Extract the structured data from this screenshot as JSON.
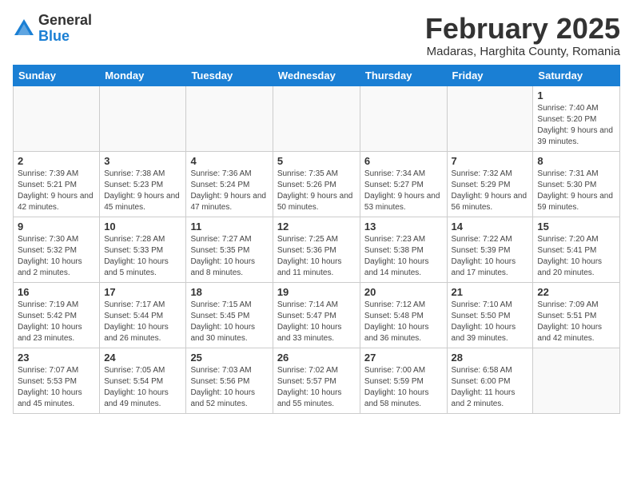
{
  "header": {
    "logo_general": "General",
    "logo_blue": "Blue",
    "title": "February 2025",
    "subtitle": "Madaras, Harghita County, Romania"
  },
  "days_of_week": [
    "Sunday",
    "Monday",
    "Tuesday",
    "Wednesday",
    "Thursday",
    "Friday",
    "Saturday"
  ],
  "weeks": [
    [
      {
        "day": "",
        "info": ""
      },
      {
        "day": "",
        "info": ""
      },
      {
        "day": "",
        "info": ""
      },
      {
        "day": "",
        "info": ""
      },
      {
        "day": "",
        "info": ""
      },
      {
        "day": "",
        "info": ""
      },
      {
        "day": "1",
        "info": "Sunrise: 7:40 AM\nSunset: 5:20 PM\nDaylight: 9 hours and 39 minutes."
      }
    ],
    [
      {
        "day": "2",
        "info": "Sunrise: 7:39 AM\nSunset: 5:21 PM\nDaylight: 9 hours and 42 minutes."
      },
      {
        "day": "3",
        "info": "Sunrise: 7:38 AM\nSunset: 5:23 PM\nDaylight: 9 hours and 45 minutes."
      },
      {
        "day": "4",
        "info": "Sunrise: 7:36 AM\nSunset: 5:24 PM\nDaylight: 9 hours and 47 minutes."
      },
      {
        "day": "5",
        "info": "Sunrise: 7:35 AM\nSunset: 5:26 PM\nDaylight: 9 hours and 50 minutes."
      },
      {
        "day": "6",
        "info": "Sunrise: 7:34 AM\nSunset: 5:27 PM\nDaylight: 9 hours and 53 minutes."
      },
      {
        "day": "7",
        "info": "Sunrise: 7:32 AM\nSunset: 5:29 PM\nDaylight: 9 hours and 56 minutes."
      },
      {
        "day": "8",
        "info": "Sunrise: 7:31 AM\nSunset: 5:30 PM\nDaylight: 9 hours and 59 minutes."
      }
    ],
    [
      {
        "day": "9",
        "info": "Sunrise: 7:30 AM\nSunset: 5:32 PM\nDaylight: 10 hours and 2 minutes."
      },
      {
        "day": "10",
        "info": "Sunrise: 7:28 AM\nSunset: 5:33 PM\nDaylight: 10 hours and 5 minutes."
      },
      {
        "day": "11",
        "info": "Sunrise: 7:27 AM\nSunset: 5:35 PM\nDaylight: 10 hours and 8 minutes."
      },
      {
        "day": "12",
        "info": "Sunrise: 7:25 AM\nSunset: 5:36 PM\nDaylight: 10 hours and 11 minutes."
      },
      {
        "day": "13",
        "info": "Sunrise: 7:23 AM\nSunset: 5:38 PM\nDaylight: 10 hours and 14 minutes."
      },
      {
        "day": "14",
        "info": "Sunrise: 7:22 AM\nSunset: 5:39 PM\nDaylight: 10 hours and 17 minutes."
      },
      {
        "day": "15",
        "info": "Sunrise: 7:20 AM\nSunset: 5:41 PM\nDaylight: 10 hours and 20 minutes."
      }
    ],
    [
      {
        "day": "16",
        "info": "Sunrise: 7:19 AM\nSunset: 5:42 PM\nDaylight: 10 hours and 23 minutes."
      },
      {
        "day": "17",
        "info": "Sunrise: 7:17 AM\nSunset: 5:44 PM\nDaylight: 10 hours and 26 minutes."
      },
      {
        "day": "18",
        "info": "Sunrise: 7:15 AM\nSunset: 5:45 PM\nDaylight: 10 hours and 30 minutes."
      },
      {
        "day": "19",
        "info": "Sunrise: 7:14 AM\nSunset: 5:47 PM\nDaylight: 10 hours and 33 minutes."
      },
      {
        "day": "20",
        "info": "Sunrise: 7:12 AM\nSunset: 5:48 PM\nDaylight: 10 hours and 36 minutes."
      },
      {
        "day": "21",
        "info": "Sunrise: 7:10 AM\nSunset: 5:50 PM\nDaylight: 10 hours and 39 minutes."
      },
      {
        "day": "22",
        "info": "Sunrise: 7:09 AM\nSunset: 5:51 PM\nDaylight: 10 hours and 42 minutes."
      }
    ],
    [
      {
        "day": "23",
        "info": "Sunrise: 7:07 AM\nSunset: 5:53 PM\nDaylight: 10 hours and 45 minutes."
      },
      {
        "day": "24",
        "info": "Sunrise: 7:05 AM\nSunset: 5:54 PM\nDaylight: 10 hours and 49 minutes."
      },
      {
        "day": "25",
        "info": "Sunrise: 7:03 AM\nSunset: 5:56 PM\nDaylight: 10 hours and 52 minutes."
      },
      {
        "day": "26",
        "info": "Sunrise: 7:02 AM\nSunset: 5:57 PM\nDaylight: 10 hours and 55 minutes."
      },
      {
        "day": "27",
        "info": "Sunrise: 7:00 AM\nSunset: 5:59 PM\nDaylight: 10 hours and 58 minutes."
      },
      {
        "day": "28",
        "info": "Sunrise: 6:58 AM\nSunset: 6:00 PM\nDaylight: 11 hours and 2 minutes."
      },
      {
        "day": "",
        "info": ""
      }
    ]
  ]
}
